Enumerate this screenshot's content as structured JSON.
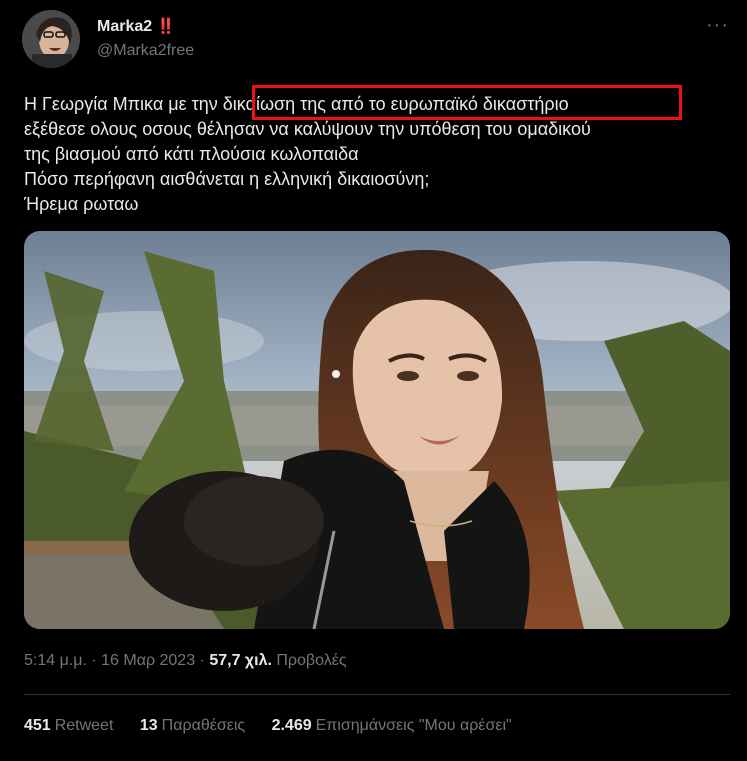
{
  "author": {
    "name": "Marka2",
    "badge": "‼️",
    "handle": "@Marka2free"
  },
  "tweet": {
    "line1_before": "Η Γεωργία Μπικα με την ",
    "line1_highlight": "δικαίωση της από το ευρωπαϊκό δικαστήριο",
    "line2": "εξέθεσε ολους οσους θέλησαν να καλύψουν την υπόθεση του ομαδικού",
    "line3": "της βιασμού  από κάτι πλούσια κωλοπαιδα",
    "line4": "Πόσο περήφανη αισθάνεται η ελληνική δικαιοσύνη;",
    "line5": "Ήρεμα ρωταω"
  },
  "meta": {
    "time": "5:14 μ.μ.",
    "sep": " · ",
    "date": "16 Μαρ 2023",
    "views": "57,7 χιλ.",
    "views_label": "Προβολές"
  },
  "stats": {
    "retweets_count": "451",
    "retweets_label": "Retweet",
    "quotes_count": "13",
    "quotes_label": "Παραθέσεις",
    "likes_count": "2.469",
    "likes_label": "Επισημάνσεις \"Μου αρέσει\""
  },
  "colors": {
    "background": "#000000",
    "text": "#e7e9ea",
    "secondary": "#71767b",
    "highlight_box": "#ee1111"
  }
}
